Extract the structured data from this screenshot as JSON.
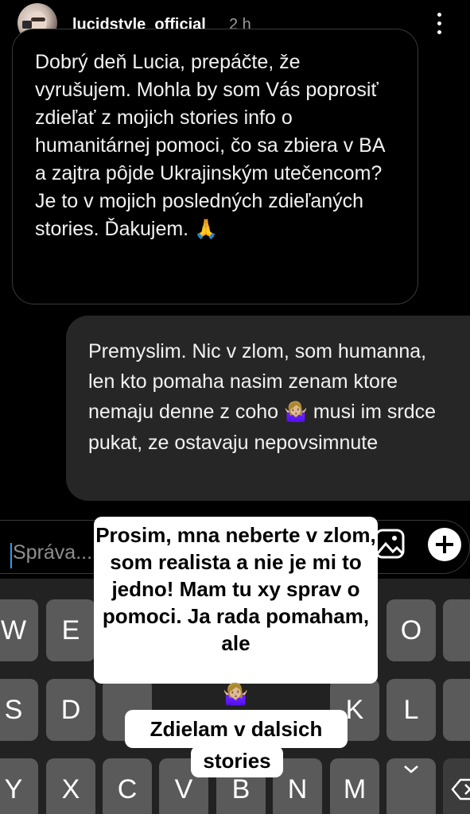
{
  "header": {
    "username": "lucidstyle_official",
    "time": "2 h"
  },
  "messages": {
    "incoming": "Dobrý deň Lucia, prepáčte, že vyrušujem. Mohla by som Vás poprosiť zdieľať z mojich stories info o humanitárnej pomoci, čo sa zbiera v BA a zajtra pôjde Ukrajinským utečencom? Je to v mojich posledných zdieľaných stories. Ďakujem.",
    "incoming_emoji": "🙏",
    "outgoing_line1": "Premyslim. Nic v zlom, som humanna, len kto pomaha nasim zenam ktore nemaju denne z coho",
    "outgoing_emoji": "🤷🏼‍♀️",
    "outgoing_line2": "musi im srdce pukat, ze ostavaju nepovsimnute"
  },
  "composer": {
    "placeholder": "Správa..."
  },
  "keyboard": {
    "row1": [
      "W",
      "E",
      "",
      "",
      "",
      "",
      "",
      "O",
      ""
    ],
    "row2": [
      "S",
      "D",
      "",
      "",
      "",
      "",
      "K",
      "L",
      ""
    ],
    "row3": [
      "Y",
      "X",
      "C",
      "V",
      "B",
      "N",
      "M",
      "",
      ""
    ]
  },
  "story_overlay": {
    "main_text": "Prosim, mna neberte v zlom, som realista a nie je mi to jedno! Mam tu xy sprav o pomoci. Ja rada pomaham, ale",
    "emoji": "🤷🏼‍♀️",
    "line2": "Zdielam v dalsich",
    "line3": "stories"
  }
}
